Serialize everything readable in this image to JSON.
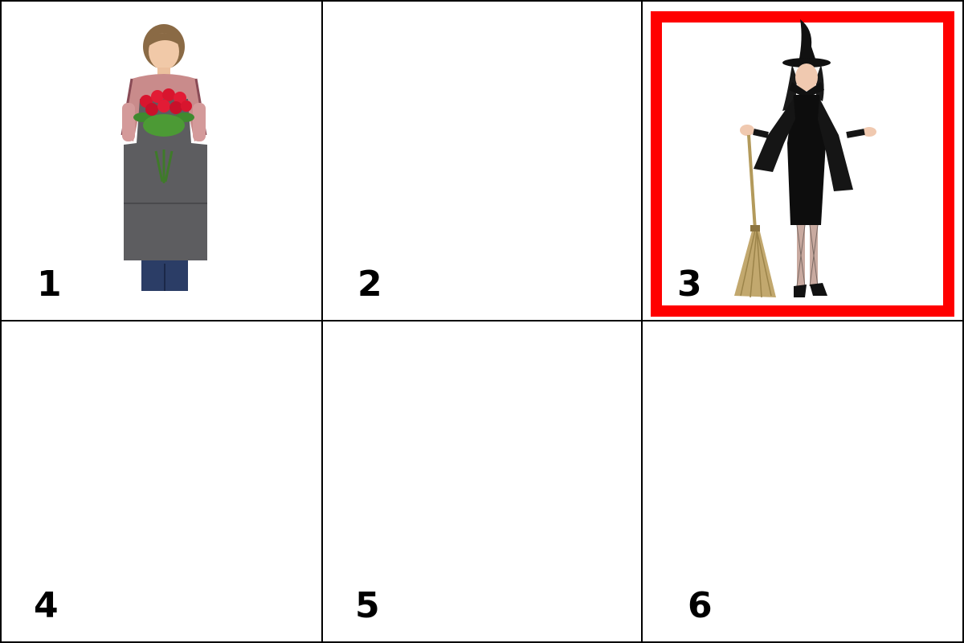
{
  "grid": {
    "tiles": [
      {
        "number": "1",
        "image_icon": "florist-woman-with-roses-icon",
        "selected": false
      },
      {
        "number": "2",
        "image_icon": "",
        "selected": false
      },
      {
        "number": "3",
        "image_icon": "witch-costume-with-broom-icon",
        "selected": true
      },
      {
        "number": "4",
        "image_icon": "",
        "selected": false
      },
      {
        "number": "5",
        "image_icon": "",
        "selected": false
      },
      {
        "number": "6",
        "image_icon": "",
        "selected": false
      }
    ]
  },
  "colors": {
    "selection_border": "#ff0000",
    "grid_lines": "#000000",
    "background": "#ffffff"
  }
}
